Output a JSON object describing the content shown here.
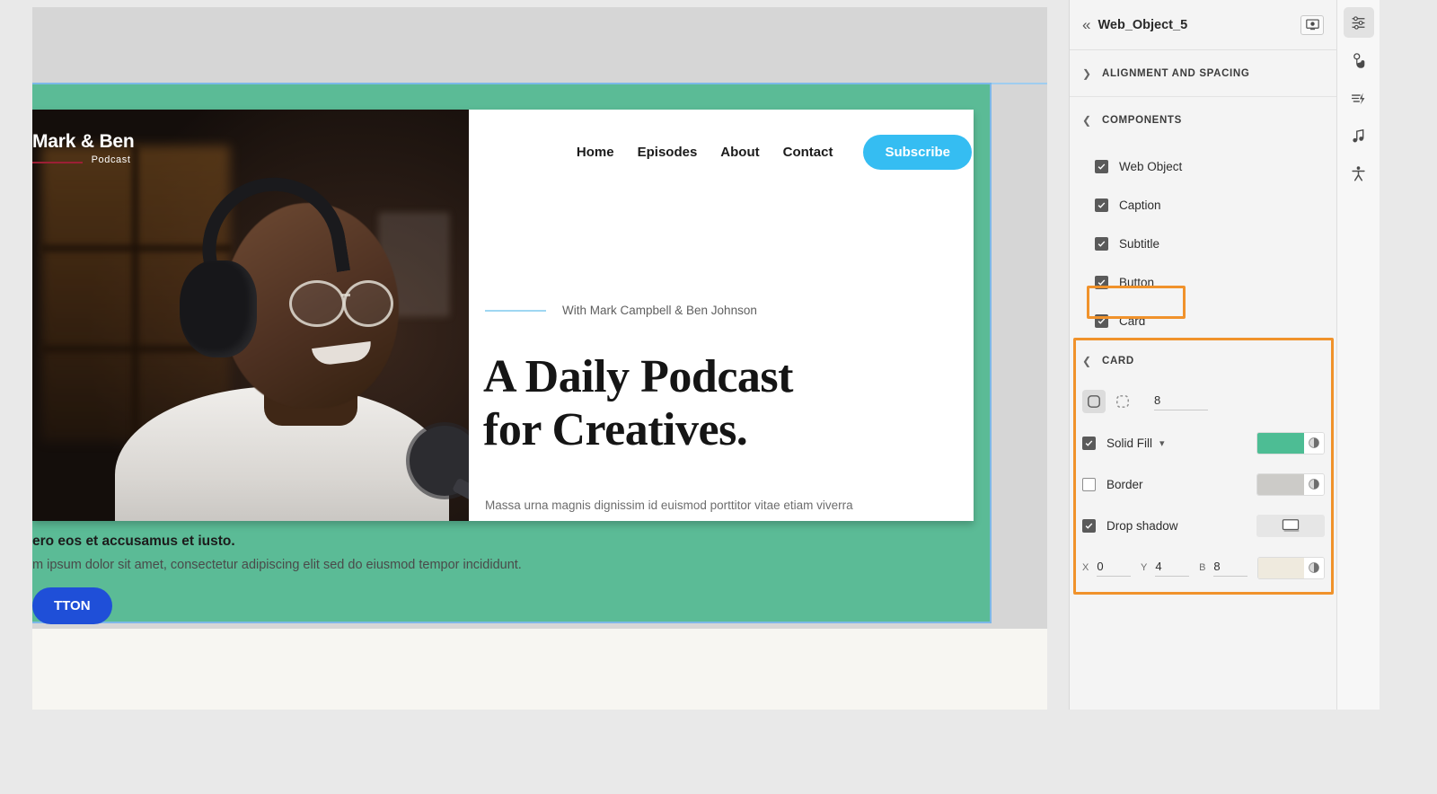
{
  "canvas": {
    "device_toolbar": {
      "options": [
        {
          "id": "desktop",
          "icon": "desktop-icon",
          "selected": true
        },
        {
          "id": "tablet",
          "icon": "tablet-icon",
          "selected": false
        },
        {
          "id": "mobile",
          "icon": "mobile-icon",
          "selected": false
        }
      ]
    },
    "website": {
      "logo": {
        "line1": "Mark & Ben",
        "line2": "Podcast"
      },
      "nav": [
        "Home",
        "Episodes",
        "About",
        "Contact"
      ],
      "subscribe_label": "Subscribe",
      "eyebrow": "With Mark Campbell & Ben Johnson",
      "headline_line1": "A Daily Podcast",
      "headline_line2": "for Creatives.",
      "subcopy": "Massa urna magnis dignissim id euismod porttitor vitae etiam viverra",
      "section_title": "ero eos et accusamus et iusto.",
      "section_subtitle": "m ipsum dolor sit amet, consectetur adipiscing elit sed do eiusmod tempor incididunt.",
      "section_button": "TTON",
      "section_fill_color": "#5bbb96",
      "subscribe_color": "#35bdf2",
      "section_button_color": "#1f4fd8"
    }
  },
  "panel": {
    "back_icon": "chevron-double-left-icon",
    "title": "Web_Object_5",
    "preview_icon": "monitor-preview-icon",
    "alignment_section": {
      "label": "ALIGNMENT AND SPACING",
      "expanded": false,
      "arrow": "chevron-right-icon"
    },
    "components_section": {
      "label": "COMPONENTS",
      "expanded": true,
      "arrow": "chevron-down-icon",
      "items": [
        {
          "label": "Web Object",
          "checked": true
        },
        {
          "label": "Caption",
          "checked": true
        },
        {
          "label": "Subtitle",
          "checked": true
        },
        {
          "label": "Button",
          "checked": true
        },
        {
          "label": "Card",
          "checked": true,
          "highlighted": true
        }
      ]
    },
    "card_section": {
      "label": "CARD",
      "expanded": true,
      "arrow": "chevron-down-icon",
      "highlighted": true,
      "corner_mode": {
        "uniform_icon": "rounded-corner-icon",
        "independent_icon": "independent-corners-icon",
        "selected": "uniform"
      },
      "corner_radius": "8",
      "solid_fill": {
        "label": "Solid Fill",
        "checked": true,
        "color": "#4dbd94",
        "dropdown_icon": "chevron-down-icon"
      },
      "border": {
        "label": "Border",
        "checked": false,
        "color": "#cccbc8"
      },
      "drop_shadow": {
        "label": "Drop shadow",
        "checked": true,
        "preview_icon": "shadow-preview-icon"
      },
      "shadow_offsets": [
        {
          "key": "X",
          "value": "0"
        },
        {
          "key": "Y",
          "value": "4"
        },
        {
          "key": "B",
          "value": "8"
        }
      ],
      "shadow_color": "#efeade"
    },
    "highlight_color": "#f0922b"
  },
  "toolbar": {
    "items": [
      {
        "icon": "sliders-properties-icon",
        "active": true
      },
      {
        "icon": "hand-interaction-icon",
        "active": false
      },
      {
        "icon": "motion-animation-icon",
        "active": false
      },
      {
        "icon": "music-note-icon",
        "active": false
      },
      {
        "icon": "accessibility-icon",
        "active": false
      }
    ]
  }
}
